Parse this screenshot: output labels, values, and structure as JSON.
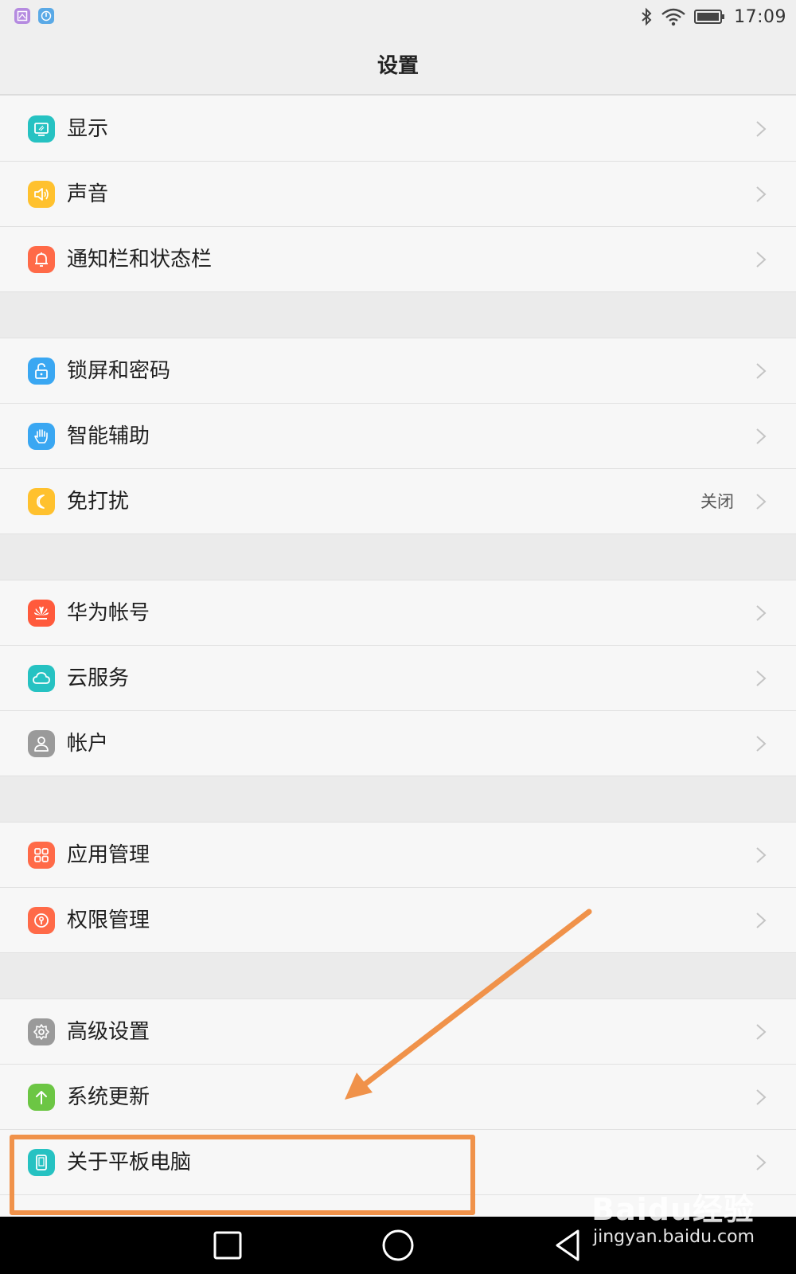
{
  "status_bar": {
    "time": "17:09"
  },
  "title": "设置",
  "groups": [
    [
      {
        "label": "显示",
        "icon": "display-icon",
        "color": "#26c2c2"
      },
      {
        "label": "声音",
        "icon": "speaker-icon",
        "color": "#ffc12e"
      },
      {
        "label": "通知栏和状态栏",
        "icon": "bell-icon",
        "color": "#ff6a48"
      }
    ],
    [
      {
        "label": "锁屏和密码",
        "icon": "unlock-icon",
        "color": "#3aa7f2"
      },
      {
        "label": "智能辅助",
        "icon": "hand-icon",
        "color": "#3aa7f2"
      },
      {
        "label": "免打扰",
        "icon": "moon-icon",
        "color": "#ffc12e",
        "value": "关闭"
      }
    ],
    [
      {
        "label": "华为帐号",
        "icon": "huawei-logo-icon",
        "color": "#ff5a3c"
      },
      {
        "label": "云服务",
        "icon": "cloud-icon",
        "color": "#26c2c2"
      },
      {
        "label": "帐户",
        "icon": "user-icon",
        "color": "#9a9a9a"
      }
    ],
    [
      {
        "label": "应用管理",
        "icon": "apps-grid-icon",
        "color": "#ff6a48"
      },
      {
        "label": "权限管理",
        "icon": "keyhole-icon",
        "color": "#ff6a48"
      }
    ],
    [
      {
        "label": "高级设置",
        "icon": "gear-icon",
        "color": "#9a9a9a"
      },
      {
        "label": "系统更新",
        "icon": "arrow-up-icon",
        "color": "#6cc644"
      },
      {
        "label": "关于平板电脑",
        "icon": "tablet-icon",
        "color": "#26c2c2"
      }
    ]
  ],
  "annotation": {
    "color": "#f0924a"
  },
  "watermark": {
    "logo": "Baidu经验",
    "url": "jingyan.baidu.com"
  }
}
